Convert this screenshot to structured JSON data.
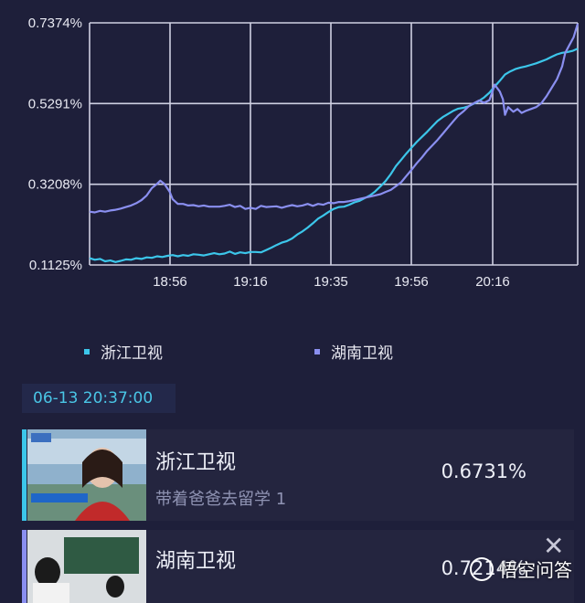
{
  "chart_data": {
    "type": "line",
    "yticks": [
      "0.7374%",
      "0.5291%",
      "0.3208%",
      "0.1125%"
    ],
    "ylim": [
      0.1125,
      0.7374
    ],
    "xticks": [
      "18:56",
      "19:16",
      "19:35",
      "19:56",
      "20:16"
    ],
    "series": [
      {
        "name": "浙江卫视",
        "color": "#3cc6ea",
        "points": [
          [
            0,
            0.13
          ],
          [
            5,
            0.126
          ],
          [
            10,
            0.128
          ],
          [
            15,
            0.122
          ],
          [
            20,
            0.124
          ],
          [
            25,
            0.12
          ],
          [
            30,
            0.123
          ],
          [
            35,
            0.127
          ],
          [
            40,
            0.126
          ],
          [
            45,
            0.13
          ],
          [
            50,
            0.128
          ],
          [
            55,
            0.132
          ],
          [
            60,
            0.131
          ],
          [
            65,
            0.135
          ],
          [
            70,
            0.133
          ],
          [
            75,
            0.136
          ],
          [
            80,
            0.138
          ],
          [
            85,
            0.135
          ],
          [
            90,
            0.138
          ],
          [
            95,
            0.136
          ],
          [
            100,
            0.14
          ],
          [
            105,
            0.139
          ],
          [
            110,
            0.137
          ],
          [
            115,
            0.14
          ],
          [
            120,
            0.143
          ],
          [
            125,
            0.14
          ],
          [
            130,
            0.142
          ],
          [
            135,
            0.147
          ],
          [
            140,
            0.141
          ],
          [
            145,
            0.145
          ],
          [
            150,
            0.143
          ],
          [
            155,
            0.146
          ],
          [
            160,
            0.146
          ],
          [
            165,
            0.145
          ],
          [
            170,
            0.151
          ],
          [
            175,
            0.157
          ],
          [
            180,
            0.164
          ],
          [
            185,
            0.17
          ],
          [
            190,
            0.174
          ],
          [
            195,
            0.181
          ],
          [
            200,
            0.191
          ],
          [
            205,
            0.199
          ],
          [
            210,
            0.209
          ],
          [
            215,
            0.22
          ],
          [
            220,
            0.232
          ],
          [
            225,
            0.24
          ],
          [
            230,
            0.249
          ],
          [
            235,
            0.257
          ],
          [
            240,
            0.262
          ],
          [
            245,
            0.263
          ],
          [
            250,
            0.268
          ],
          [
            255,
            0.274
          ],
          [
            260,
            0.278
          ],
          [
            265,
            0.285
          ],
          [
            270,
            0.292
          ],
          [
            275,
            0.302
          ],
          [
            280,
            0.315
          ],
          [
            285,
            0.329
          ],
          [
            290,
            0.347
          ],
          [
            295,
            0.368
          ],
          [
            300,
            0.384
          ],
          [
            305,
            0.4
          ],
          [
            310,
            0.415
          ],
          [
            315,
            0.43
          ],
          [
            320,
            0.443
          ],
          [
            325,
            0.456
          ],
          [
            330,
            0.47
          ],
          [
            335,
            0.484
          ],
          [
            340,
            0.494
          ],
          [
            345,
            0.502
          ],
          [
            350,
            0.51
          ],
          [
            355,
            0.516
          ],
          [
            360,
            0.518
          ],
          [
            365,
            0.522
          ],
          [
            370,
            0.529
          ],
          [
            375,
            0.536
          ],
          [
            380,
            0.545
          ],
          [
            385,
            0.557
          ],
          [
            390,
            0.573
          ],
          [
            395,
            0.588
          ],
          [
            400,
            0.604
          ],
          [
            405,
            0.612
          ],
          [
            410,
            0.618
          ],
          [
            415,
            0.622
          ],
          [
            420,
            0.625
          ],
          [
            425,
            0.629
          ],
          [
            430,
            0.633
          ],
          [
            435,
            0.638
          ],
          [
            440,
            0.643
          ],
          [
            445,
            0.65
          ],
          [
            450,
            0.656
          ],
          [
            455,
            0.66
          ],
          [
            460,
            0.662
          ],
          [
            465,
            0.665
          ],
          [
            470,
            0.671
          ]
        ]
      },
      {
        "name": "湖南卫视",
        "color": "#8a8ff0",
        "points": [
          [
            0,
            0.25
          ],
          [
            5,
            0.248
          ],
          [
            10,
            0.252
          ],
          [
            15,
            0.25
          ],
          [
            20,
            0.253
          ],
          [
            25,
            0.255
          ],
          [
            30,
            0.258
          ],
          [
            35,
            0.262
          ],
          [
            40,
            0.266
          ],
          [
            45,
            0.272
          ],
          [
            50,
            0.28
          ],
          [
            55,
            0.292
          ],
          [
            60,
            0.311
          ],
          [
            65,
            0.322
          ],
          [
            68,
            0.33
          ],
          [
            72,
            0.322
          ],
          [
            77,
            0.302
          ],
          [
            80,
            0.282
          ],
          [
            85,
            0.27
          ],
          [
            90,
            0.27
          ],
          [
            95,
            0.266
          ],
          [
            100,
            0.267
          ],
          [
            105,
            0.264
          ],
          [
            110,
            0.266
          ],
          [
            115,
            0.263
          ],
          [
            120,
            0.263
          ],
          [
            125,
            0.263
          ],
          [
            130,
            0.265
          ],
          [
            135,
            0.268
          ],
          [
            140,
            0.262
          ],
          [
            145,
            0.265
          ],
          [
            150,
            0.257
          ],
          [
            155,
            0.26
          ],
          [
            160,
            0.257
          ],
          [
            165,
            0.265
          ],
          [
            170,
            0.262
          ],
          [
            175,
            0.263
          ],
          [
            180,
            0.264
          ],
          [
            185,
            0.26
          ],
          [
            190,
            0.264
          ],
          [
            195,
            0.267
          ],
          [
            200,
            0.264
          ],
          [
            205,
            0.266
          ],
          [
            210,
            0.27
          ],
          [
            215,
            0.265
          ],
          [
            220,
            0.27
          ],
          [
            225,
            0.268
          ],
          [
            230,
            0.273
          ],
          [
            235,
            0.272
          ],
          [
            240,
            0.275
          ],
          [
            245,
            0.275
          ],
          [
            250,
            0.277
          ],
          [
            255,
            0.28
          ],
          [
            260,
            0.283
          ],
          [
            265,
            0.286
          ],
          [
            270,
            0.289
          ],
          [
            275,
            0.292
          ],
          [
            280,
            0.295
          ],
          [
            285,
            0.301
          ],
          [
            290,
            0.306
          ],
          [
            295,
            0.316
          ],
          [
            300,
            0.326
          ],
          [
            305,
            0.342
          ],
          [
            310,
            0.358
          ],
          [
            315,
            0.375
          ],
          [
            320,
            0.39
          ],
          [
            325,
            0.407
          ],
          [
            330,
            0.421
          ],
          [
            335,
            0.435
          ],
          [
            340,
            0.451
          ],
          [
            345,
            0.467
          ],
          [
            350,
            0.483
          ],
          [
            355,
            0.498
          ],
          [
            360,
            0.509
          ],
          [
            365,
            0.522
          ],
          [
            370,
            0.53
          ],
          [
            375,
            0.537
          ],
          [
            380,
            0.531
          ],
          [
            385,
            0.538
          ],
          [
            388,
            0.56
          ],
          [
            390,
            0.578
          ],
          [
            395,
            0.56
          ],
          [
            398,
            0.54
          ],
          [
            400,
            0.5
          ],
          [
            403,
            0.52
          ],
          [
            408,
            0.508
          ],
          [
            412,
            0.515
          ],
          [
            416,
            0.505
          ],
          [
            420,
            0.51
          ],
          [
            425,
            0.515
          ],
          [
            430,
            0.52
          ],
          [
            435,
            0.53
          ],
          [
            440,
            0.548
          ],
          [
            445,
            0.57
          ],
          [
            450,
            0.592
          ],
          [
            455,
            0.625
          ],
          [
            458,
            0.66
          ],
          [
            462,
            0.68
          ],
          [
            466,
            0.7
          ],
          [
            470,
            0.735
          ]
        ]
      }
    ],
    "legend": [
      "浙江卫视",
      "湖南卫视"
    ]
  },
  "timestamp": "06-13  20:37:00",
  "cards": [
    {
      "channel": "浙江卫视",
      "show": "带着爸爸去留学 1",
      "rating": "0.6731%",
      "accent": "#3cc6ea"
    },
    {
      "channel": "湖南卫视",
      "show": "",
      "rating": "0.7214%",
      "accent": "#8a8ff0"
    }
  ],
  "watermark": "悟空问答",
  "close_icon": "close-icon"
}
